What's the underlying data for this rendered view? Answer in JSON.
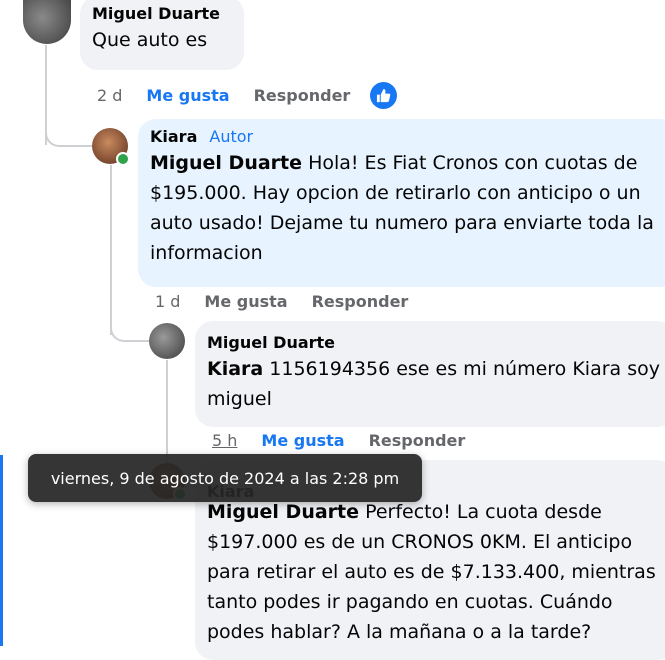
{
  "comments": [
    {
      "author": "Miguel Duarte",
      "text": "Que auto es",
      "time": "2 d",
      "like_label": "Me gusta",
      "reply_label": "Responder",
      "reaction_icon": "like-icon"
    },
    {
      "author": "Kiara",
      "author_badge": "Autor",
      "mention": "Miguel Duarte",
      "text": " Hola! Es Fiat Cronos con cuotas de $195.000. Hay opcion de retirarlo con anticipo o un auto usado! Dejame tu numero para enviarte toda la informacion",
      "time": "1 d",
      "like_label": "Me gusta",
      "reply_label": "Responder"
    },
    {
      "author": "Miguel Duarte",
      "mention": "Kiara",
      "text": " 1156194356 ese es mi número Kiara soy miguel",
      "time": "5 h",
      "like_label": "Me gusta",
      "reply_label": "Responder"
    },
    {
      "author": "Kiara",
      "mention": "Miguel Duarte",
      "text": " Perfecto! La cuota desde $197.000 es de un CRONOS 0KM. El anticipo para retirar el auto es de $7.133.400, mientras tanto podes ir pagando en cuotas. Cuándo podes hablar? A la mañana o a la tarde?"
    }
  ],
  "tooltip": "viernes, 9 de agosto de 2024 a las 2:28 pm",
  "colors": {
    "like": "#1877f2",
    "bubble_gray": "#f0f2f5",
    "bubble_blue": "#e7f3ff",
    "meta": "#65676b"
  }
}
